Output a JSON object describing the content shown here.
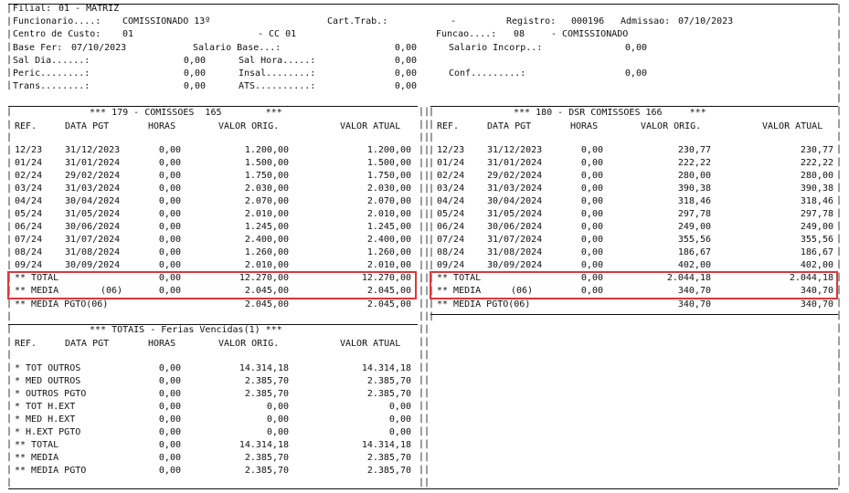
{
  "header": {
    "filial_label": "Filial:",
    "filial_value": "01 - MATRIZ",
    "funcionario_label": "Funcionario....:",
    "funcionario_value": "COMISSIONADO 13º",
    "cart_trab_label": "Cart.Trab.:",
    "cart_trab_value": "-",
    "registro_label": "Registro:",
    "registro_value": "000196",
    "admissao_label": "Admissao:",
    "admissao_value": "07/10/2023",
    "centro_custo_label": "Centro de Custo:",
    "centro_custo_value": "01",
    "cc_value": "- CC 01",
    "funcao_label": "Funcao....:",
    "funcao_value": "08",
    "funcao_name": "- COMISSIONADO",
    "base_fer_label": "Base Fer:",
    "base_fer_value": "07/10/2023",
    "salario_base_label": "Salario Base...:",
    "salario_base_value": "0,00",
    "salario_incorp_label": "Salario Incorp..:",
    "salario_incorp_value": "0,00",
    "sal_dia_label": "Sal Dia......:",
    "sal_dia_value": "0,00",
    "sal_hora_label": "Sal Hora.....:",
    "sal_hora_value": "0,00",
    "peric_label": "Peric........:",
    "peric_value": "0,00",
    "insal_label": "Insal........:",
    "insal_value": "0,00",
    "conf_label": "Conf.........:",
    "conf_value": "0,00",
    "trans_label": "Trans........:",
    "trans_value": "0,00",
    "ats_label": "ATS..........:",
    "ats_value": "0,00"
  },
  "columns": {
    "ref": "REF.",
    "data_pgt": "DATA PGT",
    "horas": "HORAS",
    "valor_orig": "VALOR ORIG.",
    "valor_atual": "VALOR ATUAL"
  },
  "section_comissoes": {
    "title": "*** 179 - COMISSOES  165        ***",
    "rows": [
      {
        "ref": "12/23",
        "data": "31/12/2023",
        "horas": "0,00",
        "orig": "1.200,00",
        "atual": "1.200,00"
      },
      {
        "ref": "01/24",
        "data": "31/01/2024",
        "horas": "0,00",
        "orig": "1.500,00",
        "atual": "1.500,00"
      },
      {
        "ref": "02/24",
        "data": "29/02/2024",
        "horas": "0,00",
        "orig": "1.750,00",
        "atual": "1.750,00"
      },
      {
        "ref": "03/24",
        "data": "31/03/2024",
        "horas": "0,00",
        "orig": "2.030,00",
        "atual": "2.030,00"
      },
      {
        "ref": "04/24",
        "data": "30/04/2024",
        "horas": "0,00",
        "orig": "2.070,00",
        "atual": "2.070,00"
      },
      {
        "ref": "05/24",
        "data": "31/05/2024",
        "horas": "0,00",
        "orig": "2.010,00",
        "atual": "2.010,00"
      },
      {
        "ref": "06/24",
        "data": "30/06/2024",
        "horas": "0,00",
        "orig": "1.245,00",
        "atual": "1.245,00"
      },
      {
        "ref": "07/24",
        "data": "31/07/2024",
        "horas": "0,00",
        "orig": "2.400,00",
        "atual": "2.400,00"
      },
      {
        "ref": "08/24",
        "data": "31/08/2024",
        "horas": "0,00",
        "orig": "1.260,00",
        "atual": "1.260,00"
      },
      {
        "ref": "09/24",
        "data": "30/09/2024",
        "horas": "0,00",
        "orig": "2.010,00",
        "atual": "2.010,00"
      }
    ],
    "total": {
      "label": "** TOTAL",
      "count": "",
      "horas": "0,00",
      "orig": "12.270,00",
      "atual": "12.270,00"
    },
    "media": {
      "label": "** MEDIA",
      "count": "(06)",
      "horas": "0,00",
      "orig": "2.045,00",
      "atual": "2.045,00"
    },
    "media_pgto": {
      "label": "** MEDIA PGTO(06)",
      "orig": "2.045,00",
      "atual": "2.045,00"
    }
  },
  "section_dsr": {
    "title": "*** 180 - DSR COMISSOES 166     ***",
    "rows": [
      {
        "ref": "12/23",
        "data": "31/12/2023",
        "horas": "0,00",
        "orig": "230,77",
        "atual": "230,77"
      },
      {
        "ref": "01/24",
        "data": "31/01/2024",
        "horas": "0,00",
        "orig": "222,22",
        "atual": "222,22"
      },
      {
        "ref": "02/24",
        "data": "29/02/2024",
        "horas": "0,00",
        "orig": "280,00",
        "atual": "280,00"
      },
      {
        "ref": "03/24",
        "data": "31/03/2024",
        "horas": "0,00",
        "orig": "390,38",
        "atual": "390,38"
      },
      {
        "ref": "04/24",
        "data": "30/04/2024",
        "horas": "0,00",
        "orig": "318,46",
        "atual": "318,46"
      },
      {
        "ref": "05/24",
        "data": "31/05/2024",
        "horas": "0,00",
        "orig": "297,78",
        "atual": "297,78"
      },
      {
        "ref": "06/24",
        "data": "30/06/2024",
        "horas": "0,00",
        "orig": "249,00",
        "atual": "249,00"
      },
      {
        "ref": "07/24",
        "data": "31/07/2024",
        "horas": "0,00",
        "orig": "355,56",
        "atual": "355,56"
      },
      {
        "ref": "08/24",
        "data": "31/08/2024",
        "horas": "0,00",
        "orig": "186,67",
        "atual": "186,67"
      },
      {
        "ref": "09/24",
        "data": "30/09/2024",
        "horas": "0,00",
        "orig": "402,00",
        "atual": "402,00"
      }
    ],
    "total": {
      "label": "** TOTAL",
      "count": "",
      "horas": "0,00",
      "orig": "2.044,18",
      "atual": "2.044,18"
    },
    "media": {
      "label": "** MEDIA",
      "count": "(06)",
      "horas": "0,00",
      "orig": "340,70",
      "atual": "340,70"
    },
    "media_pgto": {
      "label": "** MEDIA PGTO(06)",
      "orig": "340,70",
      "atual": "340,70"
    }
  },
  "section_totais": {
    "title": "*** TOTAIS - Ferias Vencidas(1) ***",
    "rows": [
      {
        "label": "* TOT OUTROS",
        "horas": "0,00",
        "orig": "14.314,18",
        "atual": "14.314,18"
      },
      {
        "label": "* MED OUTROS",
        "horas": "0,00",
        "orig": "2.385,70",
        "atual": "2.385,70"
      },
      {
        "label": "* OUTROS PGTO",
        "horas": "0,00",
        "orig": "2.385,70",
        "atual": "2.385,70"
      },
      {
        "label": "* TOT H.EXT",
        "horas": "0,00",
        "orig": "0,00",
        "atual": "0,00"
      },
      {
        "label": "* MED H.EXT",
        "horas": "0,00",
        "orig": "0,00",
        "atual": "0,00"
      },
      {
        "label": "* H.EXT PGTO",
        "horas": "0,00",
        "orig": "0,00",
        "atual": "0,00"
      },
      {
        "label": "** TOTAL",
        "horas": "0,00",
        "orig": "14.314,18",
        "atual": "14.314,18"
      },
      {
        "label": "** MEDIA",
        "horas": "0,00",
        "orig": "2.385,70",
        "atual": "2.385,70"
      },
      {
        "label": "** MEDIA PGTO",
        "horas": "0,00",
        "orig": "2.385,70",
        "atual": "2.385,70"
      }
    ]
  },
  "colors": {
    "highlight": "#d9383a",
    "text": "#111111"
  }
}
